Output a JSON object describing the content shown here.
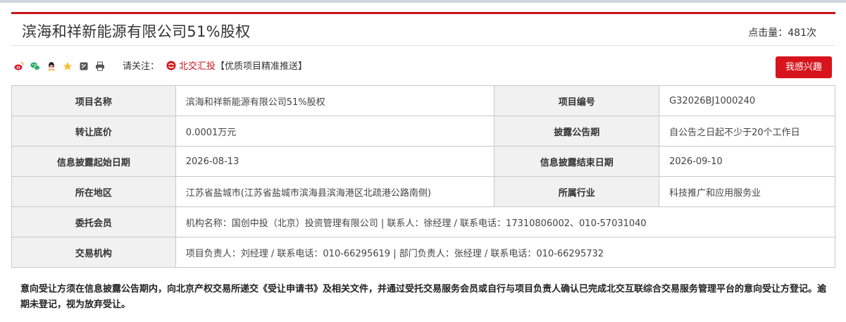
{
  "page": {
    "title": "滨海和祥新能源有限公司51%股权",
    "clicks": "点击量：481次"
  },
  "share": {
    "icons": [
      "weibo-icon",
      "wechat-icon",
      "qq-icon",
      "favorite-star-icon",
      "copy-link-icon",
      "print-icon"
    ]
  },
  "follow": {
    "label": "请关注：",
    "brand": "北交汇投",
    "tagline": "【优质项目精准推送】"
  },
  "interest_button": "我感兴趣",
  "table": {
    "r1": {
      "l1": "项目名称",
      "v1": "滨海和祥新能源有限公司51%股权",
      "l2": "项目编号",
      "v2": "G32026BJ1000240"
    },
    "r2": {
      "l1": "转让底价",
      "v1": "0.0001万元",
      "l2": "披露公告期",
      "v2": "自公告之日起不少于20个工作日"
    },
    "r3": {
      "l1": "信息披露起始日期",
      "v1": "2026-08-13",
      "l2": "信息披露结束日期",
      "v2": "2026-09-10"
    },
    "r4": {
      "l1": "所在地区",
      "v1": "江苏省盐城市(江苏省盐城市滨海县滨海港区北疏港公路南侧)",
      "l2": "所属行业",
      "v2": "科技推广和应用服务业"
    },
    "r5": {
      "l1": "委托会员",
      "v1": "机构名称：国创中投（北京）投资管理有限公司 | 联系人：徐经理 / 联系电话：17310806002、010-57031040"
    },
    "r6": {
      "l1": "交易机构",
      "v1": "项目负责人：刘经理 / 联系电话：010-66295619 | 部门负责人：张经理 / 联系电话：010-66295732"
    }
  },
  "notice": "意向受让方须在信息披露公告期内，向北京产权交易所递交《受让申请书》及相关文件，并通过受托交易服务会员或自行与项目负责人确认已完成北交互联综合交易服务管理平台的意向受让方登记。逾期未登记，视为放弃受让。",
  "colors": {
    "accent": "#d7141c",
    "label_bg": "#f1f1f1",
    "border": "#c9c9c9"
  }
}
